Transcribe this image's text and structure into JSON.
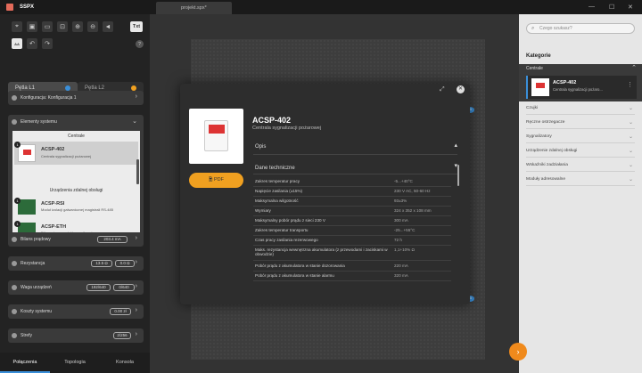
{
  "window": {
    "title": "SSPX",
    "tab": "projekt.spx*",
    "minimize": "—",
    "maximize": "☐",
    "close": "✕"
  },
  "toolbar": {
    "txt_label": "Txt",
    "aa_label": "AA"
  },
  "loops": [
    {
      "label": "Pętla L1",
      "color": "#3a8fd9",
      "active": true
    },
    {
      "label": "Pętla L2",
      "color": "#f0a020",
      "active": false
    }
  ],
  "config": {
    "label": "Konfiguracja: Konfiguracja 1"
  },
  "elements": {
    "label": "Elementy systemu",
    "centrale_header": "Centrale",
    "centrale_item": {
      "badge": "1",
      "name": "ACSP-402",
      "desc": "Centrala sygnalizacji pożarowej"
    },
    "remote_header": "Urządzenia zdalnej obsługi",
    "remote_items": [
      {
        "badge": "1",
        "name": "ACSP-RSI",
        "desc": "Moduł izolacji galwanicznej magistrali RS-485"
      },
      {
        "badge": "1",
        "name": "ACSP-ETH",
        "desc": "Ethernetowy moduł komunikacyjny"
      }
    ]
  },
  "summary_panels": [
    {
      "label": "Bilans prądowy",
      "values": [
        "203.4 mA"
      ]
    },
    {
      "label": "Rezystancja",
      "values": [
        "13.5 Ω",
        "0.0 Ω"
      ]
    },
    {
      "label": "Waga urządzeń",
      "values": [
        "192/640",
        "0/640"
      ]
    },
    {
      "label": "Koszty systemu",
      "values": [
        "0.00 zł"
      ]
    },
    {
      "label": "Strefy",
      "values": [
        "2/256"
      ]
    }
  ],
  "bottom_tabs": [
    "Połączenia",
    "Topologia",
    "Konsola"
  ],
  "right_panel": {
    "search_placeholder": "Czego szukasz?",
    "heading": "Kategorie",
    "open_category": "Centrale",
    "open_item": {
      "name": "ACSP-402",
      "desc": "Centrala sygnalizacji pożaro..."
    },
    "categories": [
      "Czujki",
      "Ręczne ostrzegacze",
      "Sygnalizatory",
      "Urządzenie zdalnej obsługi",
      "Wskaźniki zadziałania",
      "Moduły adresowalne"
    ]
  },
  "modal": {
    "title": "ACSP-402",
    "subtitle": "Centrala sygnalizacji pożarowej",
    "pdf_label": "PDF",
    "desc_label": "Opis",
    "tech_label": "Dane techniczne",
    "rows": [
      {
        "label": "Zakres temperatur pracy",
        "value": "-5...+40°C"
      },
      {
        "label": "Napięcie zasilania (±15%)",
        "value": "230 V AC, 50-60 Hz"
      },
      {
        "label": "Maksymalna wilgotność",
        "value": "93±3%"
      },
      {
        "label": "Wymiary",
        "value": "324 x 352 x 108 mm"
      },
      {
        "label": "Maksymalny pobór prądu z sieci 230 V",
        "value": "300 mA"
      },
      {
        "label": "Zakres temperatur transportu",
        "value": "-25...+55°C"
      },
      {
        "label": "Czas pracy zasilania rezerwowego",
        "value": "72 h"
      },
      {
        "label": "Maks. rezystancja wewnętrzna akumulatora (z przewodami i zaciskami w obwodzie)",
        "value": "1,1+10% Ω"
      },
      {
        "label": "Pobór prądu z akumulatora w stanie dozorowania",
        "value": "220 mA"
      },
      {
        "label": "Pobór prądu z akumulatora w stanie alarmu",
        "value": "320 mA"
      }
    ]
  },
  "canvas": {
    "node1_badge": "00",
    "node2_badge": "00"
  },
  "colors": {
    "accent": "#f08a1c",
    "loop1": "#3a8fd9",
    "loop2": "#f0a020"
  }
}
